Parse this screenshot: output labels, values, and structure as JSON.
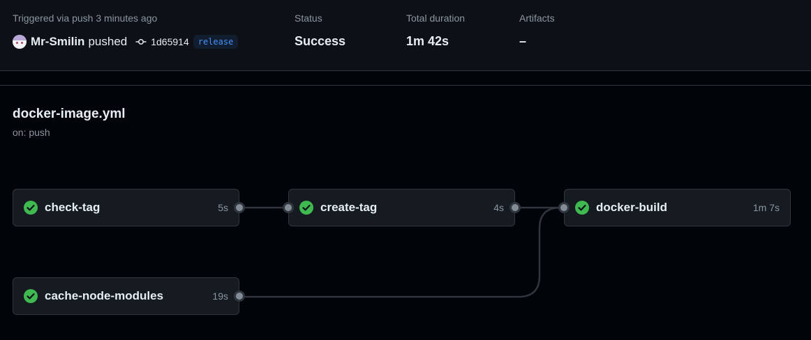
{
  "summary": {
    "trigger_text": "Triggered via push 3 minutes ago",
    "user": "Mr-Smilin",
    "action": "pushed",
    "commit_sha": "1d65914",
    "branch": "release",
    "status_label": "Status",
    "status_value": "Success",
    "duration_label": "Total duration",
    "duration_value": "1m 42s",
    "artifacts_label": "Artifacts",
    "artifacts_value": "–"
  },
  "workflow": {
    "name": "docker-image.yml",
    "trigger": "on: push"
  },
  "jobs": [
    {
      "name": "check-tag",
      "duration": "5s",
      "status": "success"
    },
    {
      "name": "create-tag",
      "duration": "4s",
      "status": "success"
    },
    {
      "name": "docker-build",
      "duration": "1m 7s",
      "status": "success"
    },
    {
      "name": "cache-node-modules",
      "duration": "19s",
      "status": "success"
    }
  ],
  "colors": {
    "success": "#3fb950",
    "link": "#4493f8"
  }
}
